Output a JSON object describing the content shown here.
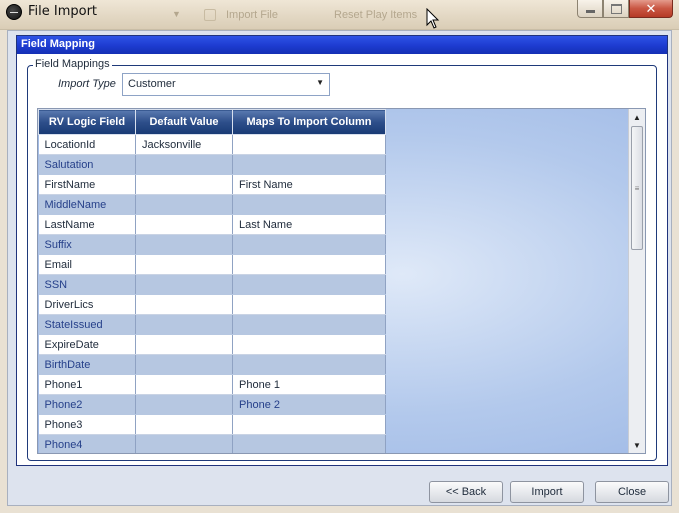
{
  "window": {
    "title": "File Import",
    "background_tabs": [
      "Import File",
      "Reset Play Items"
    ]
  },
  "panel": {
    "header": "Field Mapping",
    "group_title": "Field Mappings",
    "import_type": {
      "label": "Import Type",
      "value": "Customer"
    }
  },
  "grid": {
    "columns": [
      "RV Logic Field",
      "Default Value",
      "Maps To Import Column"
    ],
    "rows": [
      {
        "field": "LocationId",
        "default": "Jacksonville",
        "maps_to": ""
      },
      {
        "field": "Salutation",
        "default": "",
        "maps_to": ""
      },
      {
        "field": "FirstName",
        "default": "",
        "maps_to": "First Name"
      },
      {
        "field": "MiddleName",
        "default": "",
        "maps_to": ""
      },
      {
        "field": "LastName",
        "default": "",
        "maps_to": "Last Name"
      },
      {
        "field": "Suffix",
        "default": "",
        "maps_to": ""
      },
      {
        "field": "Email",
        "default": "",
        "maps_to": ""
      },
      {
        "field": "SSN",
        "default": "",
        "maps_to": ""
      },
      {
        "field": "DriverLics",
        "default": "",
        "maps_to": ""
      },
      {
        "field": "StateIssued",
        "default": "",
        "maps_to": ""
      },
      {
        "field": "ExpireDate",
        "default": "",
        "maps_to": ""
      },
      {
        "field": "BirthDate",
        "default": "",
        "maps_to": ""
      },
      {
        "field": "Phone1",
        "default": "",
        "maps_to": "Phone 1"
      },
      {
        "field": "Phone2",
        "default": "",
        "maps_to": "Phone 2"
      },
      {
        "field": "Phone3",
        "default": "",
        "maps_to": ""
      },
      {
        "field": "Phone4",
        "default": "",
        "maps_to": ""
      }
    ]
  },
  "buttons": {
    "back": "<< Back",
    "import": "Import",
    "close": "Close"
  },
  "colors": {
    "panel_header": "#1d3bd0",
    "grid_header": "#2d4e8a",
    "alt_row": "#b6c7e1",
    "alt_row_text": "#26408a"
  }
}
